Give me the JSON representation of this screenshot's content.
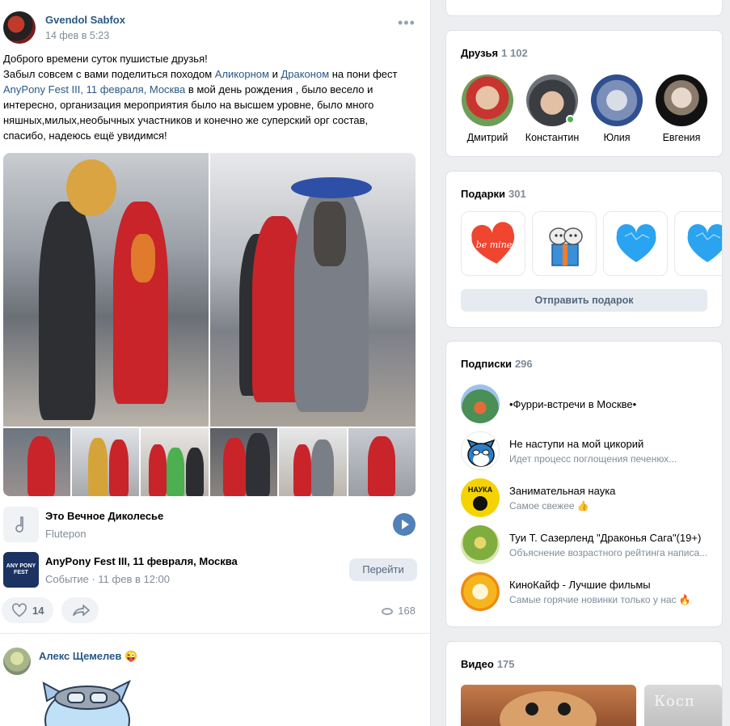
{
  "post": {
    "author": "Gvendol Sabfox",
    "date": "14 фев в 5:23",
    "more_icon": "more-horizontal-icon",
    "text_line1": "Доброго времени суток пушистые друзья!",
    "text_line2_a": "Забыл совсем с вами поделиться походом ",
    "link_alicorn": "Аликорном",
    "text_and": " и ",
    "link_dragon": "Драконом",
    "text_line2_b": " на пони фест",
    "link_event": "AnyPony Fest III, 11 февраля, Москва",
    "text_line3_a": " в мой день рождения , было весело и",
    "text_line4": "интересно, организация мероприятия было на высшем уровне, было много",
    "text_line5": "няшных,милых,необычных участников и конечно же суперский орг состав,",
    "text_line6": "спасибо, надеюсь ещё увидимся!",
    "audio": {
      "title": "Это Вечное Диколесье",
      "artist": "Flutepon",
      "icon": "music-note-icon"
    },
    "event": {
      "logo_text": "ANY PONY FEST",
      "title": "AnyPony Fest III, 11 февраля, Москва",
      "meta": "Событие · 11 фев в 12:00",
      "button": "Перейти"
    },
    "likes": "14",
    "views": "168"
  },
  "comment": {
    "author": "Алекс Щемелев",
    "emoji": "😜"
  },
  "friends": {
    "title": "Друзья",
    "count": "1 102",
    "items": [
      {
        "name": "Дмитрий",
        "color": "#b85a4a"
      },
      {
        "name": "Константин",
        "color": "#5a5f66",
        "online": true
      },
      {
        "name": "Юлия",
        "color": "#8aa0c8"
      },
      {
        "name": "Евгения",
        "color": "#2b2b2b"
      }
    ]
  },
  "gifts": {
    "title": "Подарки",
    "count": "301",
    "button": "Отправить подарок",
    "items": [
      {
        "icon": "heart-be-mine-icon",
        "text": "be mine"
      },
      {
        "icon": "cats-gift-box-icon"
      },
      {
        "icon": "blue-heart-icon"
      },
      {
        "icon": "blue-heart-icon"
      }
    ]
  },
  "subscriptions": {
    "title": "Подписки",
    "count": "296",
    "items": [
      {
        "name": "•Фурри-встречи в Москве•",
        "desc": "",
        "color": "#3f8a4e"
      },
      {
        "name": "Не наступи на мой цикорий",
        "desc": "Идет процесс поглощения печенюх...",
        "color": "#2b7fc8"
      },
      {
        "name": "Занимательная наука",
        "desc": "Самое свежее 👍",
        "color": "#f5d300",
        "logo": "НАУКА"
      },
      {
        "name": "Туи Т. Сазерленд \"Драконья Сага\"(19+)",
        "desc": "Объяснение возрастного рейтинга написа...",
        "color": "#8eb94a"
      },
      {
        "name": "КиноКайф - Лучшие фильмы",
        "desc": "Самые горячие новинки только у нас 🔥",
        "color": "#f29a1a"
      }
    ]
  },
  "videos": {
    "title": "Видео",
    "count": "175",
    "thumb2_text": "Косп"
  }
}
